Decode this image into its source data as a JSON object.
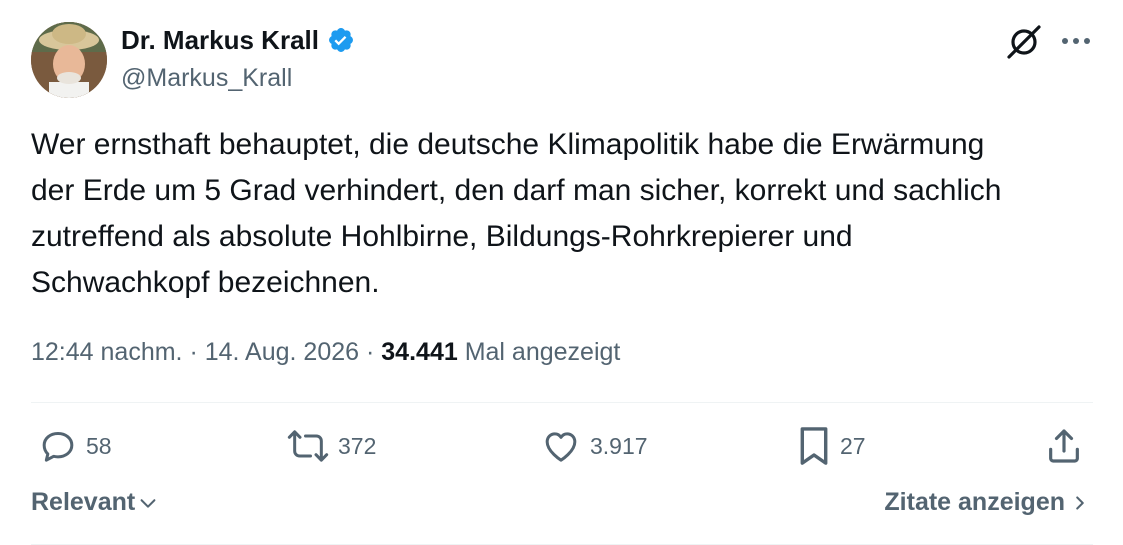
{
  "author": {
    "display_name": "Dr. Markus Krall",
    "handle": "@Markus_Krall",
    "verified": true,
    "verified_color": "#1d9bf0"
  },
  "tweet": {
    "text": "Wer ernsthaft behauptet, die deutsche Klimapolitik habe die Erwärmung\nder Erde um 5 Grad verhindert, den darf man sicher, korrekt und sachlich\nzutreffend als absolute Hohlbirne, Bildungs-Rohrkrepierer und\nSchwachkopf bezeichnen.",
    "time": "12:44 nachm.",
    "separator": "·",
    "date": "14. Aug. 2026",
    "views_count": "34.441",
    "views_label": "Mal angezeigt"
  },
  "actions": {
    "reply_count": "58",
    "repost_count": "372",
    "like_count": "3.917",
    "bookmark_count": "27",
    "icons": [
      "reply-icon",
      "repost-icon",
      "like-icon",
      "bookmark-icon",
      "share-icon"
    ]
  },
  "footer": {
    "sort_label": "Relevant",
    "quotes_label": "Zitate anzeigen"
  },
  "header_icons": [
    "grok-icon",
    "more-icon"
  ],
  "colors": {
    "text_primary": "#0f1419",
    "text_secondary": "#536471",
    "divider": "#eff3f4",
    "accent": "#1d9bf0"
  }
}
